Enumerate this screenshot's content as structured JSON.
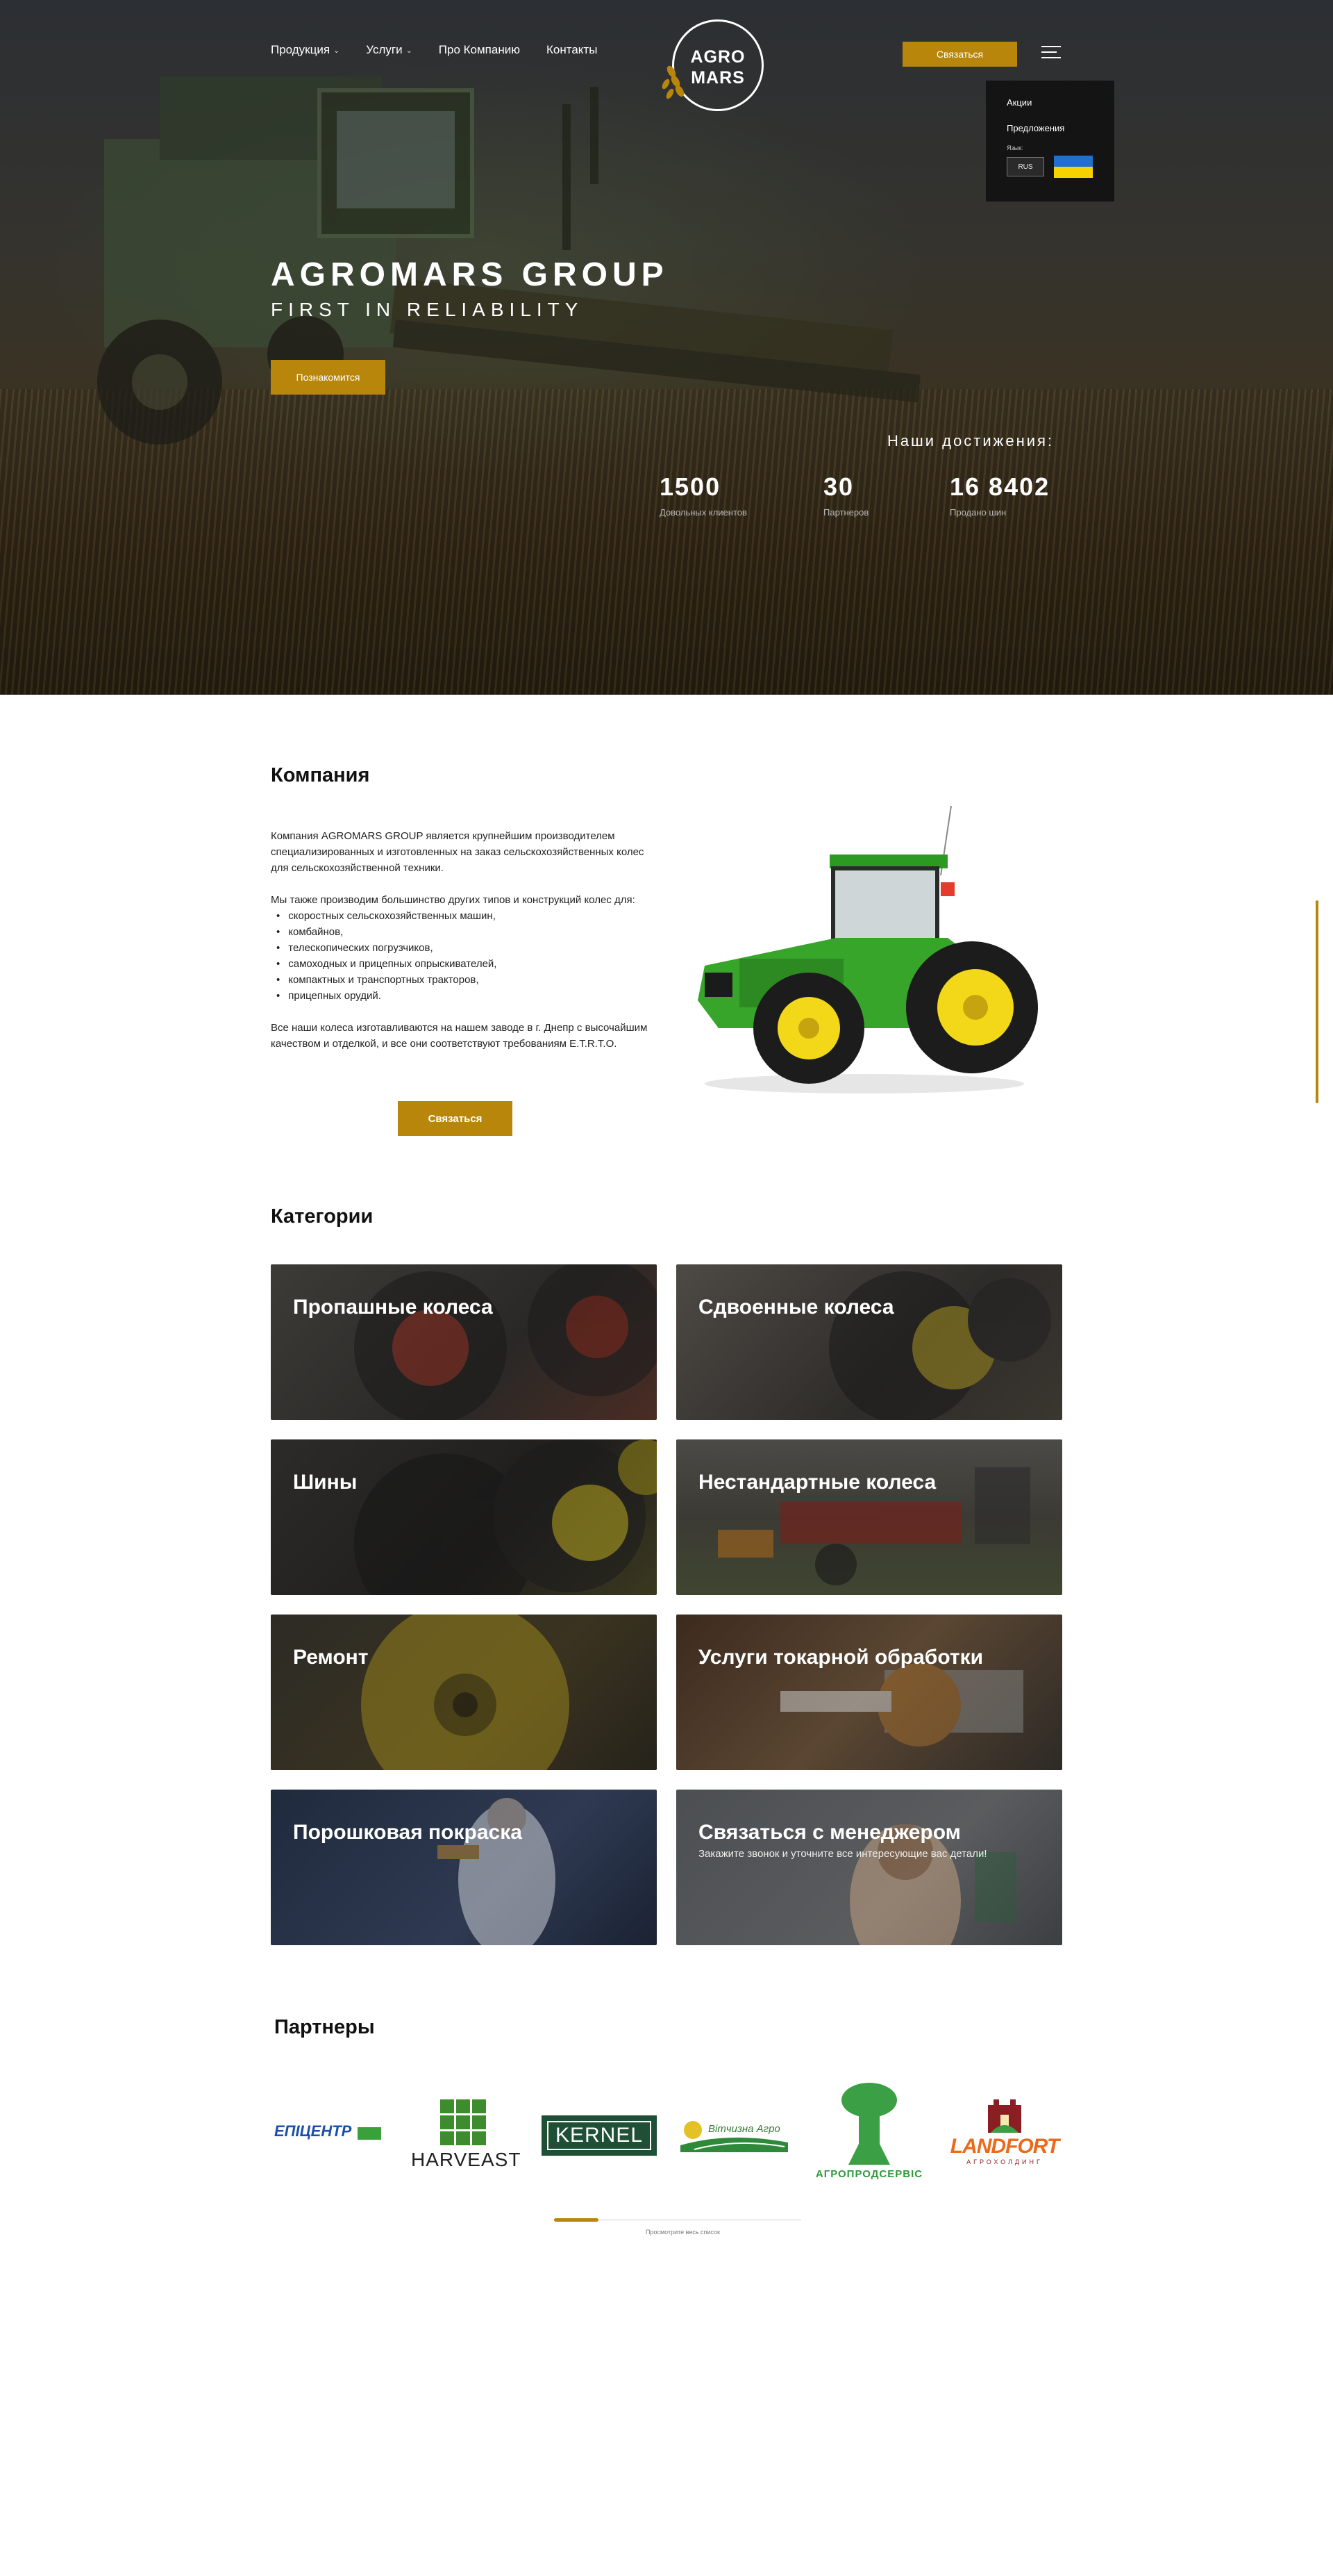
{
  "header": {
    "nav": [
      {
        "label": "Продукция",
        "dropdown": true
      },
      {
        "label": "Услуги",
        "dropdown": true
      },
      {
        "label": "Про Компанию",
        "dropdown": false
      },
      {
        "label": "Контакты",
        "dropdown": false
      }
    ],
    "logo_line1": "AGRO",
    "logo_line2": "MARS",
    "contact_button": "Связаться",
    "menu": {
      "items": [
        "Акции",
        "Предложения"
      ],
      "lang_label": "Язык:",
      "lang_current": "RUS"
    }
  },
  "hero": {
    "title": "AGROMARS GROUP",
    "subtitle": "FIRST IN RELIABILITY",
    "button": "Познакомится",
    "achievements_title": "Наши достижения:",
    "stats": [
      {
        "value": "1500",
        "label": "Довольных клиентов"
      },
      {
        "value": "30",
        "label": "Партнеров"
      },
      {
        "value": "16 8402",
        "label": "Продано шин"
      }
    ]
  },
  "company": {
    "title": "Компания",
    "intro": "Компания AGROMARS GROUP является крупнейшим производителем специализированных и изготовленных на заказ сельскохозяйственных колес для сельскохозяйственной техники.",
    "list_intro": "Мы также производим большинство других типов и конструкций колес для:",
    "list": [
      "скоростных сельскохозяйственных машин,",
      "комбайнов,",
      "телескопических погрузчиков,",
      "самоходных и прицепных опрыскивателей,",
      "компактных и транспортных тракторов,",
      "прицепных орудий."
    ],
    "outro": "Все наши колеса изготавливаются на нашем заводе в г. Днепр с высочайшим качеством и отделкой, и все они соответствуют требованиям E.T.R.T.O.",
    "button": "Связаться"
  },
  "categories": {
    "title": "Категории",
    "items": [
      {
        "title": "Пропашные колеса"
      },
      {
        "title": "Сдвоенные колеса"
      },
      {
        "title": "Шины"
      },
      {
        "title": "Нестандартные колеса"
      },
      {
        "title": "Ремонт"
      },
      {
        "title": "Услуги токарной обработки"
      },
      {
        "title": "Порошковая покраска"
      },
      {
        "title": "Связаться с менеджером",
        "subtitle": "Закажите звонок и уточните все интересующие вас детали!"
      }
    ]
  },
  "partners": {
    "title": "Партнеры",
    "logos": [
      "ЕПІЦЕНТР",
      "HARVEAST",
      "KERNEL",
      "Вітчизна Агро",
      "АГРОПРОДСЕРВІС",
      "LANDFORT",
      "АГРОХОЛДИНГ"
    ],
    "progress_label": "Просмотрите весь список",
    "progress_fraction": 0.18
  },
  "colors": {
    "accent": "#b8860b",
    "dark": "#141414"
  }
}
